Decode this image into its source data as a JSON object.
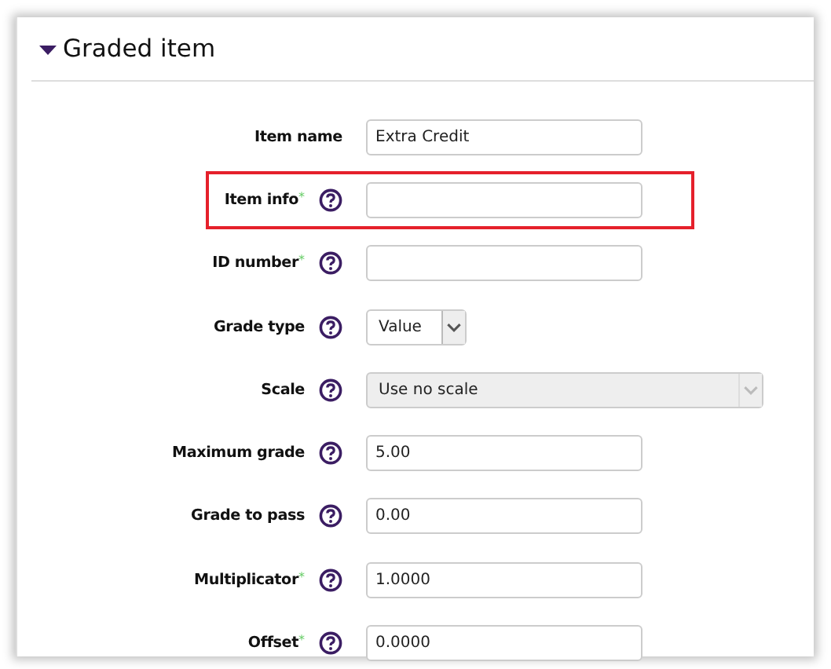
{
  "section": {
    "title": "Graded item",
    "expanded": true
  },
  "fields": [
    {
      "label": "Item name",
      "advanced": false,
      "help": false,
      "kind": "text",
      "value": "Extra Credit",
      "highlighted": false
    },
    {
      "label": "Item info",
      "advanced": true,
      "help": true,
      "kind": "text",
      "highlighted": true
    },
    {
      "label": "ID number",
      "advanced": true,
      "help": true,
      "kind": "text",
      "highlighted": false
    },
    {
      "label": "Grade type",
      "advanced": false,
      "help": true,
      "kind": "select",
      "value": "Value",
      "disabled": false,
      "highlighted": false
    },
    {
      "label": "Scale",
      "advanced": false,
      "help": true,
      "kind": "select",
      "value": "Use no scale",
      "disabled": true,
      "highlighted": false
    },
    {
      "label": "Maximum grade",
      "advanced": false,
      "help": true,
      "kind": "text",
      "value": "5.00",
      "highlighted": false
    },
    {
      "label": "Grade to pass",
      "advanced": false,
      "help": true,
      "kind": "text",
      "value": "0.00",
      "highlighted": false
    },
    {
      "label": "Multiplicator",
      "advanced": true,
      "help": true,
      "kind": "text",
      "value": "1.0000",
      "highlighted": false
    },
    {
      "label": "Offset",
      "advanced": true,
      "help": true,
      "kind": "text",
      "value": "0.0000",
      "highlighted": false
    }
  ],
  "advanced_mark": "*"
}
